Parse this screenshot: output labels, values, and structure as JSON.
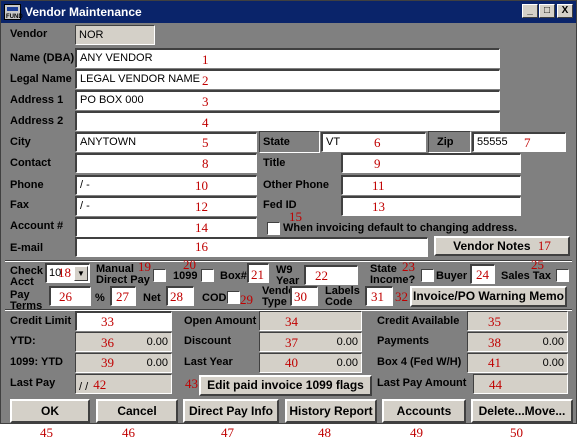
{
  "window": {
    "title": "Vendor Maintenance",
    "icon_text": "FUND",
    "minimize": "_",
    "maximize": "□",
    "close": "X"
  },
  "vendor": {
    "label": "Vendor",
    "value": "NOR"
  },
  "fields": {
    "name": {
      "label": "Name (DBA)",
      "value": "ANY VENDOR",
      "num": "1"
    },
    "legal": {
      "label": "Legal Name",
      "value": "LEGAL VENDOR NAME",
      "num": "2"
    },
    "address1": {
      "label": "Address 1",
      "value": "PO BOX 000",
      "num": "3"
    },
    "address2": {
      "label": "Address 2",
      "value": "",
      "num": "4"
    },
    "city": {
      "label": "City",
      "value": "ANYTOWN",
      "num": "5"
    },
    "state": {
      "label": "State",
      "value": "VT",
      "num": "6"
    },
    "zip": {
      "label": "Zip",
      "value": "55555",
      "num": "7"
    },
    "contact": {
      "label": "Contact",
      "value": "",
      "num": "8"
    },
    "title": {
      "label": "Title",
      "value": "",
      "num": "9"
    },
    "phone": {
      "label": "Phone",
      "value": "  /   -",
      "num": "10"
    },
    "other_phone": {
      "label": "Other Phone",
      "value": "",
      "num": "11"
    },
    "fax": {
      "label": "Fax",
      "value": "  /   -",
      "num": "12"
    },
    "fed_id": {
      "label": "Fed ID",
      "value": "",
      "num": "13"
    },
    "account": {
      "label": "Account #",
      "value": "",
      "num": "14"
    },
    "invoicing_default": {
      "label": "When invoicing default to changing address.",
      "num": "15"
    },
    "email": {
      "label": "E-mail",
      "value": "",
      "num": "16"
    },
    "vendor_notes": {
      "label": "Vendor Notes",
      "num": "17"
    }
  },
  "row2": {
    "check_acct": {
      "label1": "Check",
      "label2": "Acct",
      "value": "10",
      "num": "18"
    },
    "manual_direct_pay": {
      "label1": "Manual",
      "label2": "Direct Pay",
      "num": "19"
    },
    "f1099": {
      "label": "1099",
      "num": "20"
    },
    "box": {
      "label": "Box#",
      "num": "21"
    },
    "w9_year": {
      "label1": "W9",
      "label2": "Year",
      "num": "22"
    },
    "state_income": {
      "label1": "State",
      "label2": "Income?",
      "num": "23"
    },
    "buyer": {
      "label": "Buyer",
      "num": "24"
    },
    "sales_tax": {
      "label": "Sales Tax",
      "num": "25"
    },
    "pay_terms": {
      "label1": "Pay",
      "label2": "Terms",
      "num": "26"
    },
    "percent": {
      "label": "%",
      "num": "27"
    },
    "net": {
      "label": "Net",
      "num": "28"
    },
    "cod": {
      "label": "COD",
      "num": "29"
    },
    "vendor_type": {
      "label1": "Vendor",
      "label2": "Type",
      "num": "30"
    },
    "labels_code": {
      "label1": "Labels",
      "label2": "Code",
      "num": "31"
    },
    "warning_memo": {
      "label": "Invoice/PO Warning Memo",
      "num": "32"
    }
  },
  "totals": {
    "credit_limit": {
      "label": "Credit Limit",
      "num": "33"
    },
    "open_amount": {
      "label": "Open Amount",
      "num": "34"
    },
    "credit_available": {
      "label": "Credit Available",
      "num": "35"
    },
    "ytd": {
      "label": "YTD:",
      "value": "0.00",
      "num": "36"
    },
    "discount": {
      "label": "Discount",
      "value": "0.00",
      "num": "37"
    },
    "payments": {
      "label": "Payments",
      "value": "0.00",
      "num": "38"
    },
    "ytd_1099": {
      "label": "1099: YTD",
      "value": "0.00",
      "num": "39"
    },
    "last_year": {
      "label": "Last Year",
      "value": "0.00",
      "num": "40"
    },
    "box4": {
      "label": "Box 4 (Fed W/H)",
      "value": "0.00",
      "num": "41"
    },
    "last_pay": {
      "label": "Last Pay",
      "value": "/ /",
      "num": "42"
    },
    "edit_1099": {
      "label": "Edit paid invoice 1099 flags",
      "num": "43"
    },
    "last_pay_amount": {
      "label": "Last Pay Amount",
      "num": "44"
    }
  },
  "buttons": [
    {
      "label": "OK",
      "num": "45"
    },
    {
      "label": "Cancel",
      "num": "46"
    },
    {
      "label": "Direct Pay Info",
      "num": "47"
    },
    {
      "label": "History Report",
      "num": "48"
    },
    {
      "label": "Accounts",
      "num": "49"
    },
    {
      "label": "Delete...Move...",
      "num": "50"
    }
  ]
}
